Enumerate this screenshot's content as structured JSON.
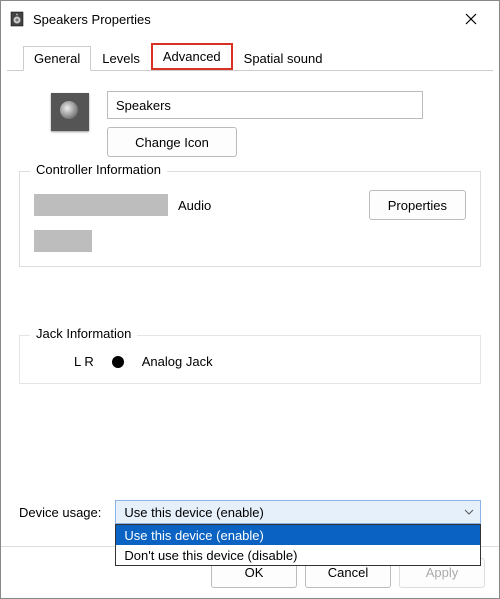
{
  "window": {
    "title": "Speakers Properties"
  },
  "tabs": {
    "general": "General",
    "levels": "Levels",
    "advanced": "Advanced",
    "spatial": "Spatial sound"
  },
  "device": {
    "name_value": "Speakers",
    "change_icon": "Change Icon"
  },
  "controller": {
    "group_title": "Controller Information",
    "vendor_suffix": "Audio",
    "properties_btn": "Properties"
  },
  "jack": {
    "group_title": "Jack Information",
    "lr": "L R",
    "type": "Analog Jack"
  },
  "usage": {
    "label": "Device usage:",
    "selected": "Use this device (enable)",
    "options": [
      "Use this device (enable)",
      "Don't use this device (disable)"
    ]
  },
  "buttons": {
    "ok": "OK",
    "cancel": "Cancel",
    "apply": "Apply"
  }
}
